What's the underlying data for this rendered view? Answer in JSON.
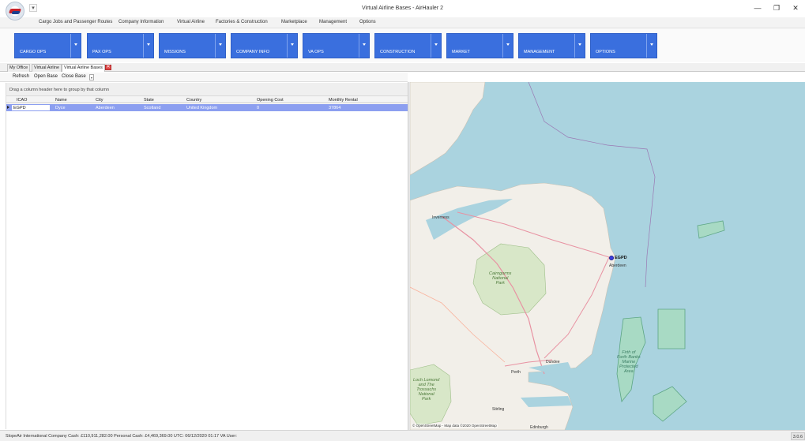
{
  "window": {
    "title": "Virtual Airline Bases - AirHauler 2",
    "minimize": "—",
    "maximize": "❐",
    "close": "✕"
  },
  "qat": {
    "label": "▾"
  },
  "menu": [
    "Cargo Jobs and Passenger Routes",
    "Company Information",
    "Virtual Airline",
    "Factories & Construction",
    "Marketplace",
    "Management",
    "Options"
  ],
  "ribbon": [
    "CARGO OPS",
    "PAX OPS",
    "MISSIONS",
    "COMPANY INFO",
    "VA OPS",
    "CONSTRUCTION",
    "MARKET",
    "MANAGEMENT",
    "OPTIONS"
  ],
  "tabs": [
    "My Office",
    "Virtual Airline",
    "Virtual Airline Bases"
  ],
  "tab_close": "✕",
  "toolbar": {
    "refresh": "Refresh",
    "open_base": "Open Base",
    "close_base": "Close Base"
  },
  "grid": {
    "group_hint": "Drag a column header here to group by that column",
    "columns": [
      "ICAO",
      "Name",
      "City",
      "State",
      "Country",
      "Opening Cost",
      "Monthly Rental"
    ],
    "rows": [
      [
        "EGPD",
        "Dyce",
        "Aberdeen",
        "Scotland",
        "United Kingdom",
        "0",
        "37864"
      ]
    ]
  },
  "map": {
    "marker_label": "EGPD",
    "towns": {
      "inverness": "Inverness",
      "aberdeen": "Aberdeen",
      "perth": "Perth",
      "dundee": "Dundee",
      "stirling": "Stirling",
      "edinburgh": "Edinburgh"
    },
    "park1": [
      "Cairngorms",
      "National",
      "Park"
    ],
    "park2": [
      "Loch Lomond",
      "and The",
      "Trossachs",
      "National",
      "Park"
    ],
    "mpa": [
      "Firth of",
      "Forth Banks",
      "Marine",
      "Protected",
      "Area"
    ],
    "attribution": "© OpenStreetMap - Map data ©2020 OpenStreetMap",
    "colors": {
      "sea": "#aad3df",
      "land": "#f2efe9",
      "park": "#d8e7c8",
      "mpa": "#a8dcc0"
    }
  },
  "status": {
    "text": "SlopeAir International   Company Cash: £110,911,282.00   Personal Cash: £4,469,369.00   UTC: 06/12/2020  01:17   VA User:",
    "version": "3.0.6"
  }
}
